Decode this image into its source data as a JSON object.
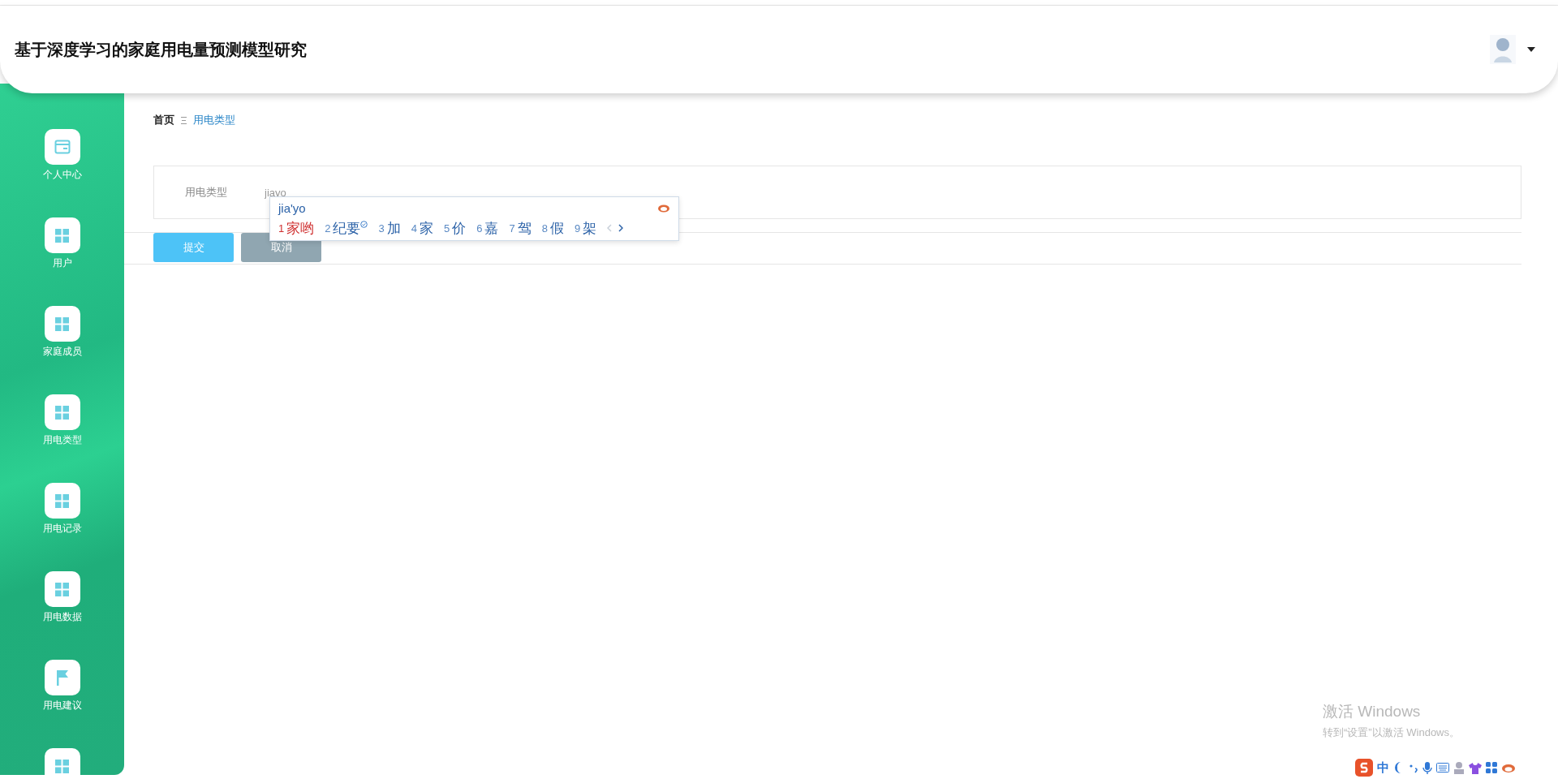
{
  "header": {
    "title": "基于深度学习的家庭用电量预测模型研究"
  },
  "sidebar": {
    "items": [
      {
        "kind": "labelled",
        "label": "个人中心"
      },
      {
        "kind": "labelled",
        "label": "用户"
      },
      {
        "kind": "labelled",
        "label": "家庭成员"
      },
      {
        "kind": "labelled",
        "label": "用电类型"
      },
      {
        "kind": "labelled",
        "label": "用电记录"
      },
      {
        "kind": "labelled",
        "label": "用电数据"
      },
      {
        "kind": "labelled",
        "label": "用电建议"
      },
      {
        "kind": "cut_off"
      }
    ]
  },
  "breadcrumb": [
    "首页",
    "用电类型"
  ],
  "form": {
    "fields": [
      {
        "label": "用电类型",
        "value": "jiayo"
      }
    ],
    "buttons": [
      {
        "label": "提交",
        "kind": "primary"
      },
      {
        "label": "取消",
        "kind": "secondary"
      }
    ]
  },
  "ime": {
    "composition": "jia'yo",
    "candidates": [
      {
        "number": "1",
        "text": "家哟",
        "selected": true,
        "verified": false
      },
      {
        "number": "2",
        "text": "纪要",
        "selected": false,
        "verified": true
      },
      {
        "number": "3",
        "text": "加",
        "selected": false,
        "verified": false
      },
      {
        "number": "4",
        "text": "家",
        "selected": false,
        "verified": false
      },
      {
        "number": "5",
        "text": "价",
        "selected": false,
        "verified": false
      },
      {
        "number": "6",
        "text": "嘉",
        "selected": false,
        "verified": false
      },
      {
        "number": "7",
        "text": "驾",
        "selected": false,
        "verified": false
      },
      {
        "number": "8",
        "text": "假",
        "selected": false,
        "verified": false
      },
      {
        "number": "9",
        "text": "架",
        "selected": false,
        "verified": false
      }
    ],
    "prev_disabled": true,
    "next_disabled": false,
    "toolbar": {
      "mode": "中"
    }
  },
  "activation": {
    "title": "激活 Windows",
    "subtitle": "转到“设置”以激活 Windows。"
  }
}
